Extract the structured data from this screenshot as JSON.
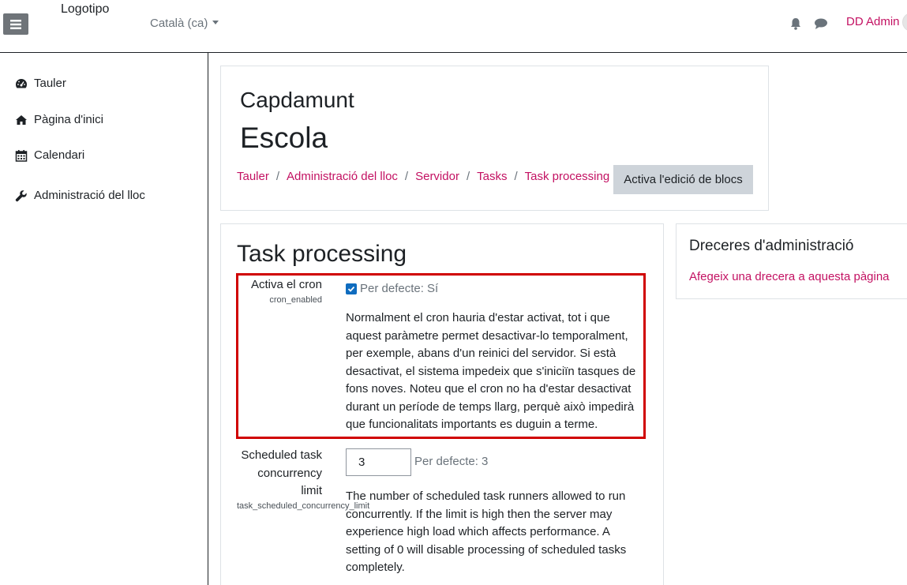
{
  "navbar": {
    "logo_text": "Logotipo",
    "language": "Català (ca)",
    "user_name": "DD Admin"
  },
  "sidebar": {
    "items": [
      {
        "label": "Tauler",
        "icon": "dashboard-icon"
      },
      {
        "label": "Pàgina d'inici",
        "icon": "home-icon"
      },
      {
        "label": "Calendari",
        "icon": "calendar-icon"
      },
      {
        "label": "Administració del lloc",
        "icon": "wrench-icon"
      }
    ]
  },
  "header": {
    "site_short": "Capdamunt",
    "site_full": "Escola",
    "breadcrumb": [
      "Tauler",
      "Administració del lloc",
      "Servidor",
      "Tasks",
      "Task processing"
    ],
    "edit_blocks_label": "Activa l'edició de blocs"
  },
  "main": {
    "heading": "Task processing",
    "settings": [
      {
        "label": "Activa el cron",
        "key": "cron_enabled",
        "checked": true,
        "default": "Per defecte: Sí",
        "description_lines": [
          "Normalment el cron hauria d'estar activat, tot i que",
          "aquest paràmetre permet desactivar-lo temporalment,",
          "per exemple, abans d'un reinici del servidor. Si està",
          "desactivat, el sistema impedeix que s'iniciïn tasques de",
          "fons noves. Noteu que el cron no ha d'estar desactivat",
          "durant un període de temps llarg, perquè això impedirà",
          "que funcionalitats importants es duguin a terme."
        ]
      },
      {
        "label_lines": [
          "Scheduled task",
          "concurrency",
          "limit"
        ],
        "key": "task_scheduled_concurrency_limit",
        "value": "3",
        "default": "Per defecte: 3",
        "description_lines": [
          "The number of scheduled task runners allowed to run",
          "concurrently. If the limit is high then the server may",
          "experience high load which affects performance. A",
          "setting of 0 will disable processing of scheduled tasks",
          "completely."
        ]
      }
    ]
  },
  "admin_block": {
    "title": "Dreceres d'administració",
    "link": "Afegeix una drecera a aquesta pàgina"
  },
  "colors": {
    "link": "#c31162",
    "highlight_border": "#d00000",
    "checkbox": "#0f6cbf"
  }
}
